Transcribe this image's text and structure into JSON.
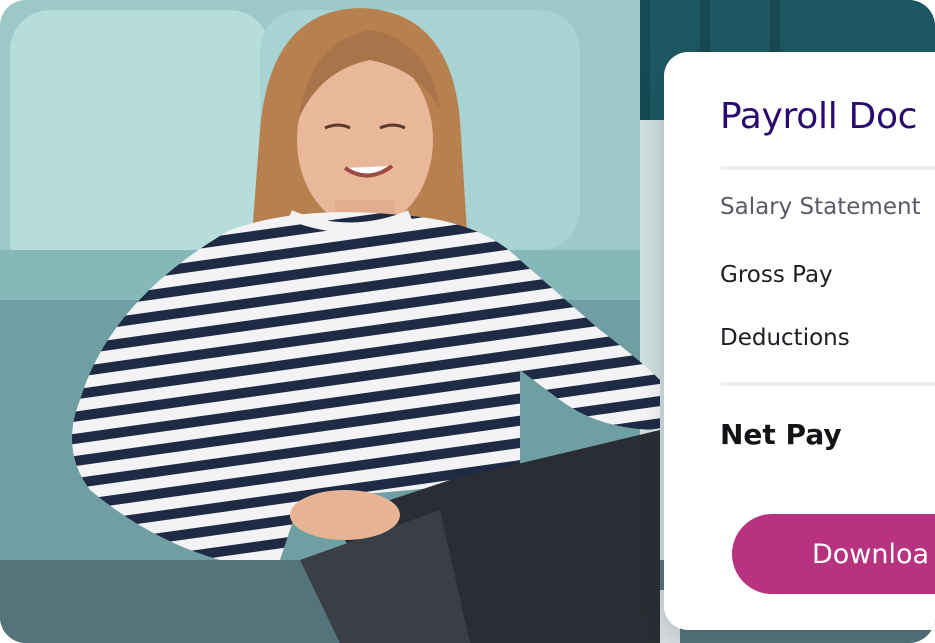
{
  "card": {
    "title": "Payroll Doc",
    "subtitle": "Salary Statement",
    "rows": [
      {
        "label": "Gross Pay"
      },
      {
        "label": "Deductions"
      }
    ],
    "net_label": "Net Pay",
    "download_label": "Downloa"
  },
  "colors": {
    "title": "#2a0a6e",
    "button": "#b8337f",
    "card_background": "#ffffff"
  }
}
